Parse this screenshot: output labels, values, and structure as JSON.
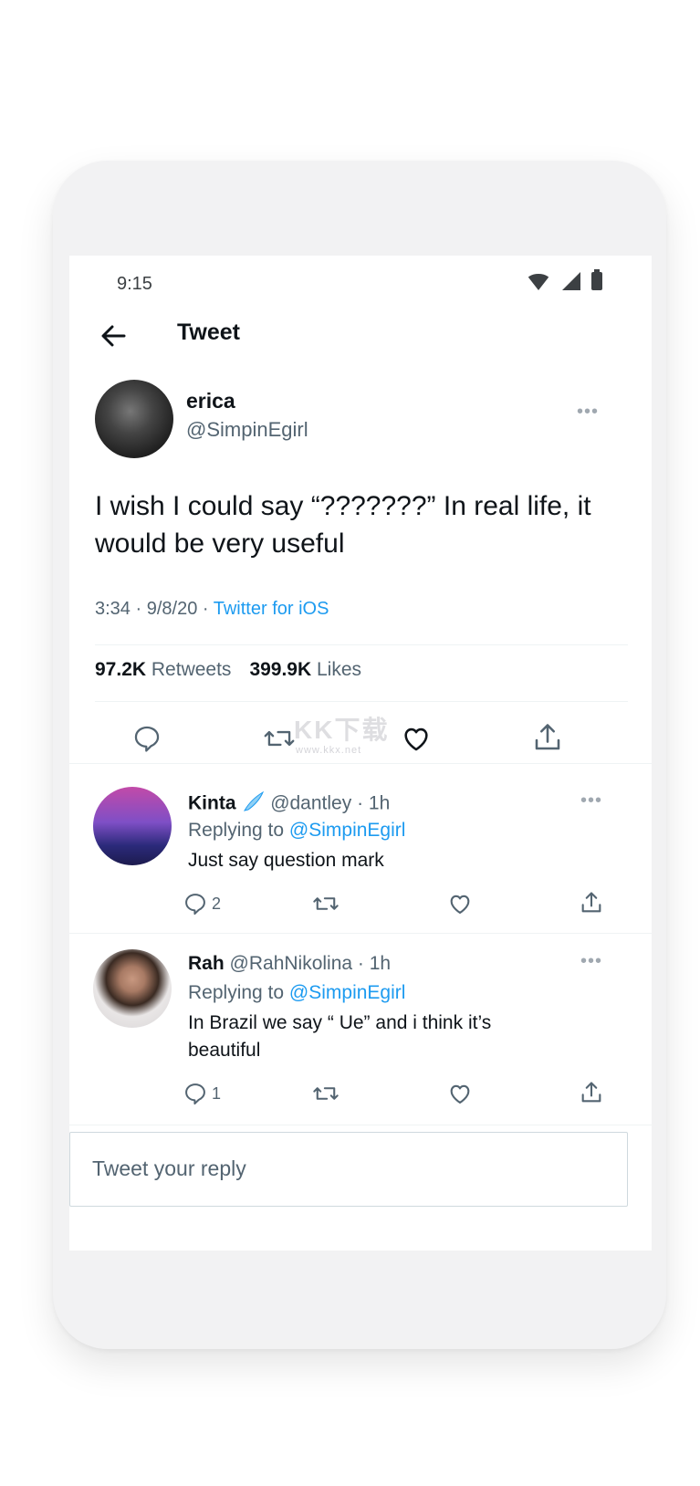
{
  "status_bar": {
    "time": "9:15"
  },
  "header": {
    "title": "Tweet"
  },
  "main_tweet": {
    "author_name": "erica",
    "author_handle": "@SimpinEgirl",
    "text": "I wish I could say “???????” In real life, it would be very useful",
    "time": "3:34",
    "date": "9/8/20",
    "source": "Twitter for iOS",
    "retweets_count": "97.2K",
    "retweets_label": "Retweets",
    "likes_count": "399.9K",
    "likes_label": "Likes"
  },
  "replies": [
    {
      "name": "Kinta",
      "handle": "@dantley",
      "age": "1h",
      "replying_label": "Replying to",
      "replying_to": "@SimpinEgirl",
      "text": "Just say question mark",
      "reply_count": "2"
    },
    {
      "name": "Rah",
      "handle": "@RahNikolina",
      "age": "1h",
      "replying_label": "Replying to",
      "replying_to": "@SimpinEgirl",
      "text": "In Brazil we say “ Ue” and i think it’s beautiful",
      "reply_count": "1"
    }
  ],
  "composer": {
    "placeholder": "Tweet your reply"
  },
  "watermark": {
    "text": "KK下载",
    "url": "www.kkx.net"
  },
  "colors": {
    "accent": "#1d9bf0",
    "text": "#0f1419",
    "muted": "#536471"
  }
}
